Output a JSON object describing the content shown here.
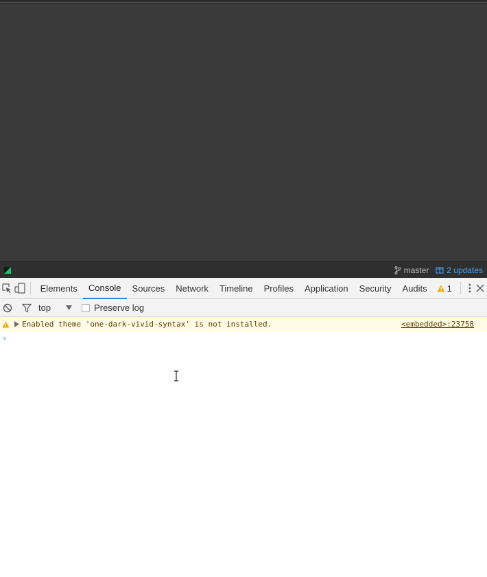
{
  "status_bar": {
    "branch": "master",
    "updates": "2 updates"
  },
  "devtools": {
    "tabs": [
      {
        "label": "Elements"
      },
      {
        "label": "Console"
      },
      {
        "label": "Sources"
      },
      {
        "label": "Network"
      },
      {
        "label": "Timeline"
      },
      {
        "label": "Profiles"
      },
      {
        "label": "Application"
      },
      {
        "label": "Security"
      },
      {
        "label": "Audits"
      }
    ],
    "active_tab": "Console",
    "warning_count": "1"
  },
  "console_toolbar": {
    "context": "top",
    "preserve_log_label": "Preserve log"
  },
  "console": {
    "warning_message": "Enabled theme 'one-dark-vivid-syntax' is not installed.",
    "warning_source": "<embedded>:23758",
    "prompt_symbol": "›"
  },
  "colors": {
    "editor_bg": "#3a3a3a",
    "status_bar_bg": "#2f2f2f",
    "accent_blue": "#3879d9",
    "updates_blue": "#4aa3f0",
    "warning_bg": "#fffbe5",
    "warning_icon": "#f2a600",
    "git_green": "#1ec26a"
  }
}
